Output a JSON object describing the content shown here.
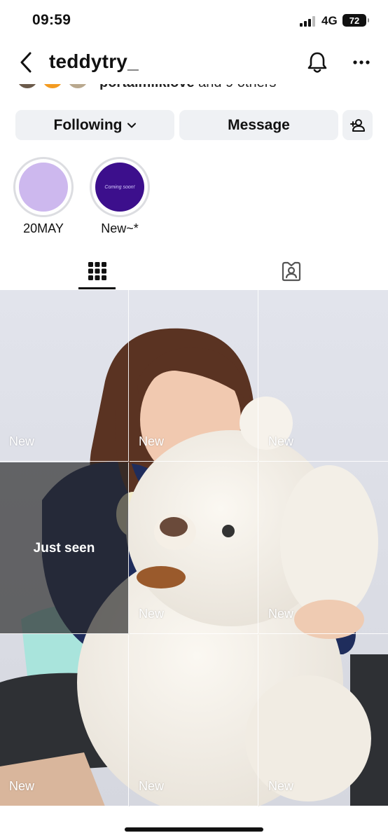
{
  "status_bar": {
    "time": "09:59",
    "network": "4G",
    "battery": "72"
  },
  "header": {
    "username": "teddytry_"
  },
  "mutual": {
    "name": "portalmilklove",
    "rest": "and 9 others"
  },
  "buttons": {
    "following": "Following",
    "message": "Message"
  },
  "highlights": [
    {
      "label": "20MAY",
      "color": "#cdb8ee",
      "inner_text": ""
    },
    {
      "label": "New~*",
      "color": "#3c0f8c",
      "inner_text": "Coming soon!"
    }
  ],
  "tabs": {
    "active": "grid-icon",
    "inactive": "tagged-icon"
  },
  "grid": {
    "cells": [
      {
        "badge": "New",
        "seen": false
      },
      {
        "badge": "New",
        "seen": false
      },
      {
        "badge": "New",
        "seen": false
      },
      {
        "badge": "",
        "seen": true,
        "seen_label": "Just seen"
      },
      {
        "badge": "New",
        "seen": false
      },
      {
        "badge": "New",
        "seen": false
      },
      {
        "badge": "New",
        "seen": false
      },
      {
        "badge": "New",
        "seen": false
      },
      {
        "badge": "New",
        "seen": false
      }
    ]
  },
  "colors": {
    "button_bg": "#eff1f4",
    "seen_overlay": "rgba(40,40,40,0.68)"
  }
}
